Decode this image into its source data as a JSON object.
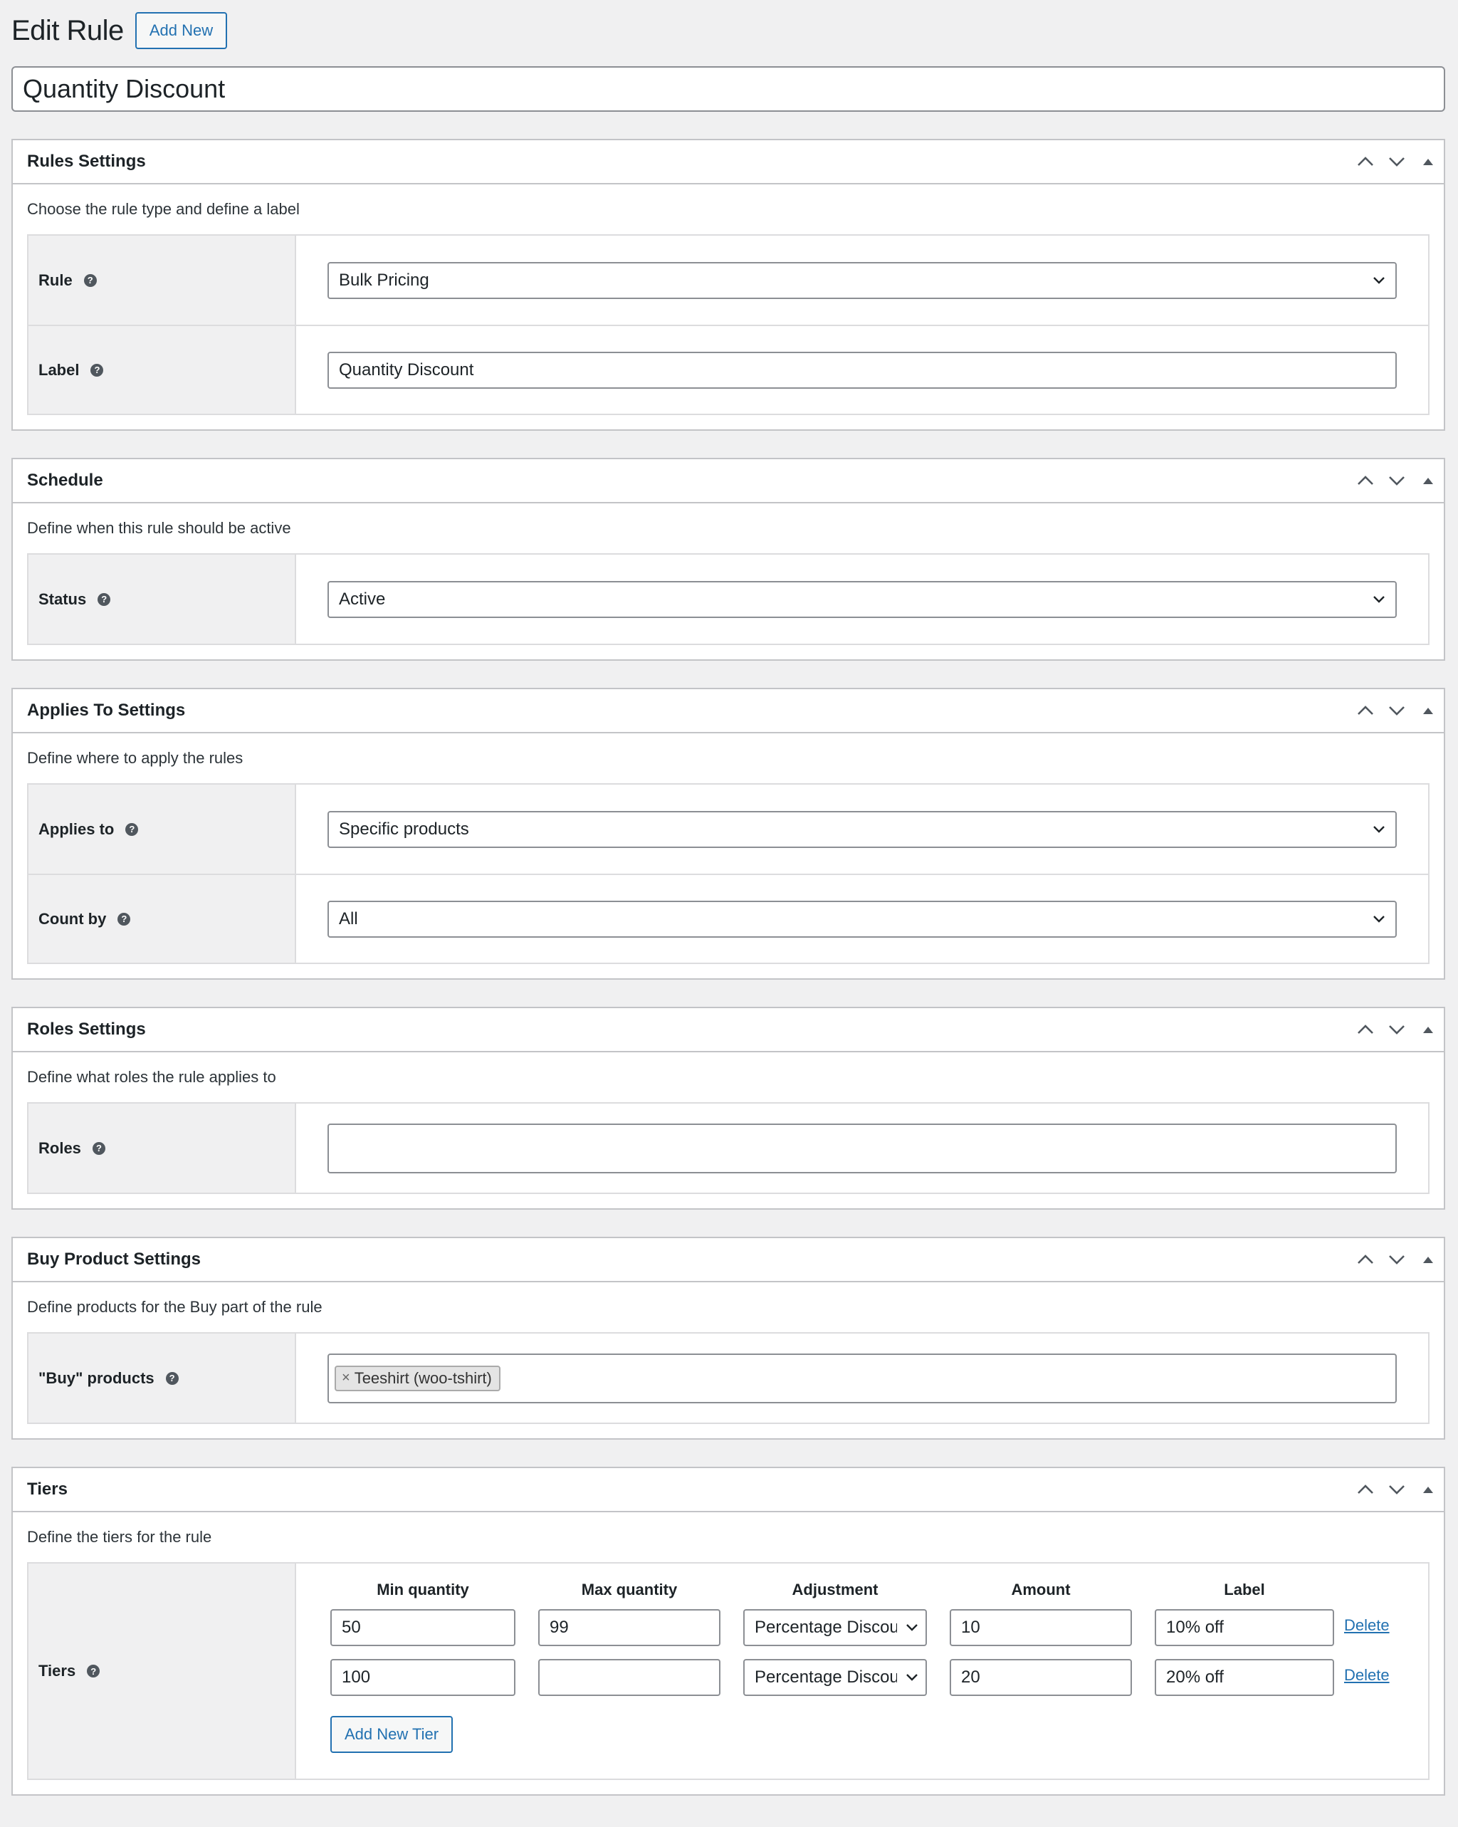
{
  "header": {
    "title": "Edit Rule",
    "add_new_label": "Add New"
  },
  "rule_title": "Quantity Discount",
  "help_glyph": "?",
  "sections": {
    "rules": {
      "title": "Rules Settings",
      "description": "Choose the rule type and define a label",
      "rule_label": "Rule",
      "rule_value": "Bulk Pricing",
      "label_label": "Label",
      "label_value": "Quantity Discount"
    },
    "schedule": {
      "title": "Schedule",
      "description": "Define when this rule should be active",
      "status_label": "Status",
      "status_value": "Active"
    },
    "applies": {
      "title": "Applies To Settings",
      "description": "Define where to apply the rules",
      "applies_label": "Applies to",
      "applies_value": "Specific products",
      "count_label": "Count by",
      "count_value": "All"
    },
    "roles": {
      "title": "Roles Settings",
      "description": "Define what roles the rule applies to",
      "roles_label": "Roles",
      "roles_value": ""
    },
    "buy": {
      "title": "Buy Product Settings",
      "description": "Define products for the Buy part of the rule",
      "products_label": "\"Buy\" products",
      "token_remove": "×",
      "token_label": "Teeshirt (woo-tshirt)"
    },
    "tiers": {
      "title": "Tiers",
      "description": "Define the tiers for the rule",
      "tiers_label": "Tiers",
      "columns": [
        "Min quantity",
        "Max quantity",
        "Adjustment",
        "Amount",
        "Label"
      ],
      "rows": [
        {
          "min": "50",
          "max": "99",
          "adjustment": "Percentage Discount",
          "amount": "10",
          "label": "10% off",
          "delete": "Delete"
        },
        {
          "min": "100",
          "max": "",
          "adjustment": "Percentage Discount",
          "amount": "20",
          "label": "20% off",
          "delete": "Delete"
        }
      ],
      "add_tier_label": "Add New Tier"
    }
  },
  "icons": {
    "move_up": "chevron-up-icon",
    "move_down": "chevron-down-icon",
    "toggle": "triangle-up-icon",
    "select_arrow": "chevron-down-icon",
    "help": "help-icon"
  },
  "colors": {
    "accent": "#2271b1",
    "background": "#f0f0f1",
    "border": "#c3c4c7"
  }
}
